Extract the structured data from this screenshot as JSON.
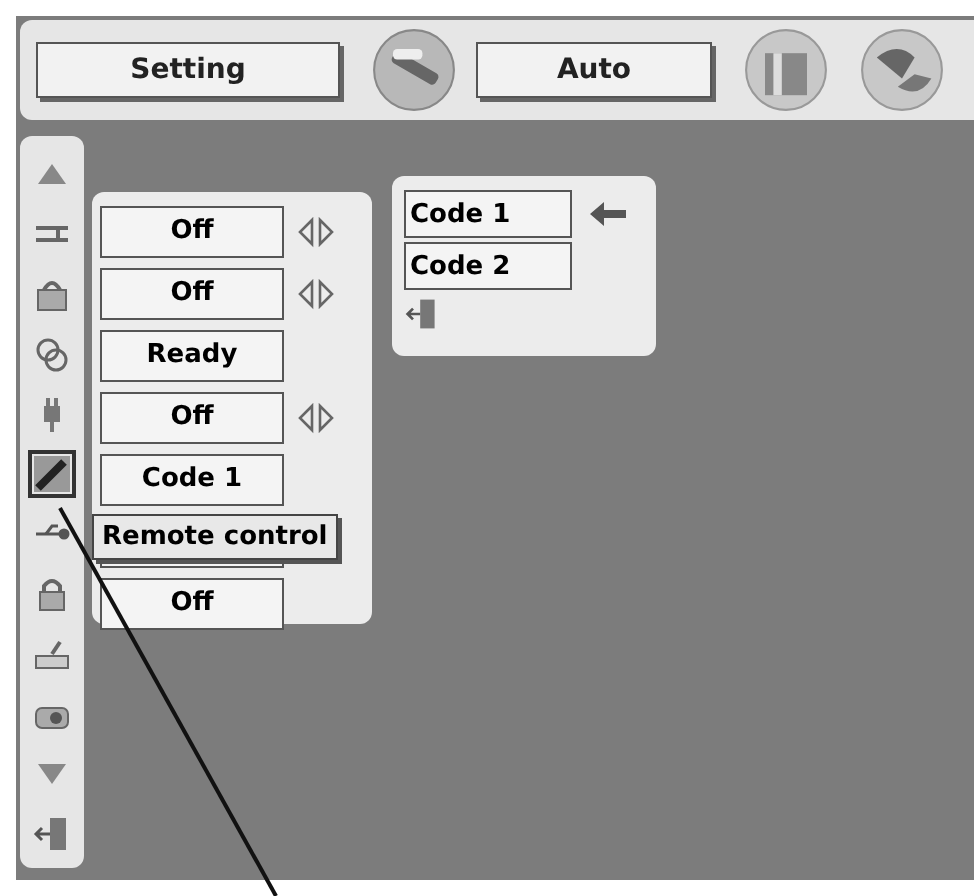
{
  "top_bar": [
    {
      "kind": "button",
      "label": "Setting"
    },
    {
      "kind": "tools-icon"
    },
    {
      "kind": "button",
      "label": "Auto"
    },
    {
      "kind": "column-icon"
    },
    {
      "kind": "globe-icon"
    }
  ],
  "sidebar": {
    "items": [
      {
        "kind": "up",
        "selected": false
      },
      {
        "kind": "lines",
        "selected": false
      },
      {
        "kind": "lock",
        "selected": false
      },
      {
        "kind": "circles",
        "selected": false
      },
      {
        "kind": "plug",
        "selected": false
      },
      {
        "kind": "pen",
        "selected": true
      },
      {
        "kind": "usb",
        "selected": false
      },
      {
        "kind": "padlock",
        "selected": false
      },
      {
        "kind": "key",
        "selected": false
      },
      {
        "kind": "camera",
        "selected": false
      },
      {
        "kind": "down",
        "selected": false
      },
      {
        "kind": "exit",
        "selected": false
      }
    ]
  },
  "menu": {
    "rows": [
      {
        "value": "Off",
        "arrows": true
      },
      {
        "value": "Off",
        "arrows": true
      },
      {
        "value": "Ready",
        "arrows": false
      },
      {
        "value": "Off",
        "arrows": true
      },
      {
        "value": "Code 1",
        "arrows": false
      },
      {
        "value": "",
        "arrows": false
      },
      {
        "value": "Off",
        "arrows": false
      }
    ],
    "tooltip": "Remote control"
  },
  "submenu": {
    "options": [
      {
        "label": "Code 1",
        "selected": true
      },
      {
        "label": "Code 2",
        "selected": false
      }
    ]
  }
}
